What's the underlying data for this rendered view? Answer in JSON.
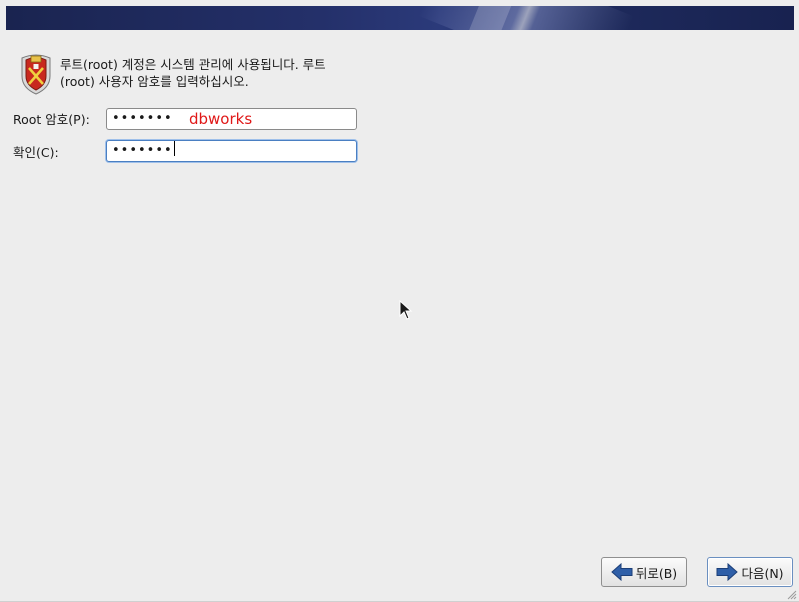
{
  "header": {
    "banner_icon": "gradient-banner"
  },
  "intro": {
    "icon": "shield-icon",
    "line1": "루트(root) 계정은 시스템 관리에 사용됩니다. 루트",
    "line2": "(root) 사용자 암호를 입력하십시오."
  },
  "form": {
    "root_password_label": "Root 암호(P):",
    "root_password_value": "•••••••",
    "confirm_label": "확인(C):",
    "confirm_value": "•••••••"
  },
  "annotation": {
    "text": "dbworks",
    "color": "#e01818"
  },
  "buttons": {
    "back_label": "뒤로(B)",
    "next_label": "다음(N)"
  },
  "colors": {
    "banner": "#1e2a5c",
    "background": "#ededed",
    "arrow": "#2f5fa8"
  }
}
